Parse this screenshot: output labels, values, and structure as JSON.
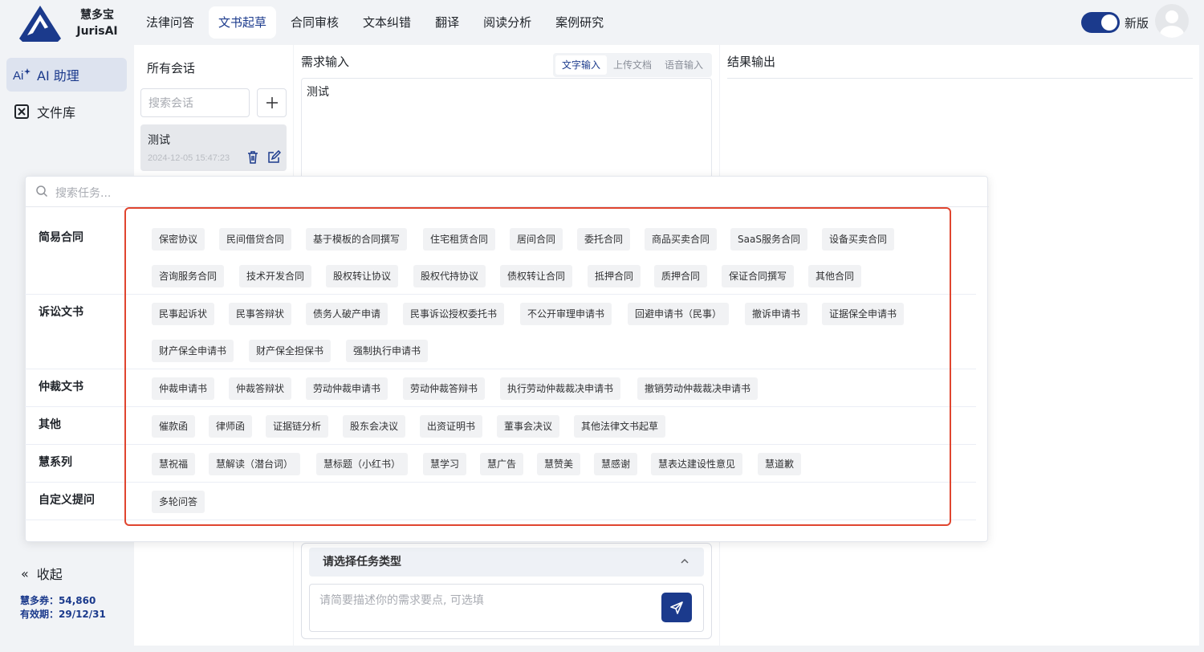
{
  "brand": {
    "name": "慧多宝",
    "sub": "JurisAI"
  },
  "nav": {
    "items": [
      "法律问答",
      "文书起草",
      "合同审核",
      "文本纠错",
      "翻译",
      "阅读分析",
      "案例研究"
    ],
    "active_index": 1
  },
  "header": {
    "version_label": "新版",
    "toggle_on": true
  },
  "sidebar": {
    "items": [
      {
        "label": "AI 助理",
        "icon": "ai-sparkle-icon"
      },
      {
        "label": "文件库",
        "icon": "box-x-icon"
      }
    ],
    "collapse_label": "收起",
    "credits_label": "慧多券：54,860",
    "expiry_label": "有效期：29/12/31"
  },
  "conversations": {
    "title": "所有会话",
    "search_placeholder": "搜索会话",
    "items": [
      {
        "name": "测试",
        "time": "2024-12-05 15:47:23"
      }
    ]
  },
  "request": {
    "title": "需求输入",
    "tabs": [
      "文字输入",
      "上传文档",
      "语音输入"
    ],
    "active_tab": 0,
    "text": "测试",
    "task_select_label": "请选择任务类型",
    "input_placeholder": "请简要描述你的需求要点, 可选填"
  },
  "output": {
    "title": "结果输出"
  },
  "task_popup": {
    "search_placeholder": "搜索任务...",
    "categories": [
      {
        "name": "简易合同",
        "rows": [
          [
            "保密协议",
            "民间借贷合同",
            "基于模板的合同撰写",
            "住宅租赁合同",
            "居间合同",
            "委托合同",
            "商品买卖合同",
            "SaaS服务合同",
            "设备买卖合同"
          ],
          [
            "咨询服务合同",
            "技术开发合同",
            "股权转让协议",
            "股权代持协议",
            "债权转让合同",
            "抵押合同",
            "质押合同",
            "保证合同撰写",
            "其他合同"
          ]
        ]
      },
      {
        "name": "诉讼文书",
        "rows": [
          [
            "民事起诉状",
            "民事答辩状",
            "债务人破产申请",
            "民事诉讼授权委托书",
            "不公开审理申请书",
            "回避申请书（民事）",
            "撤诉申请书",
            "证据保全申请书"
          ],
          [
            "财产保全申请书",
            "财产保全担保书",
            "强制执行申请书"
          ]
        ]
      },
      {
        "name": "仲裁文书",
        "rows": [
          [
            "仲裁申请书",
            "仲裁答辩状",
            "劳动仲裁申请书",
            "劳动仲裁答辩书",
            "执行劳动仲裁裁决申请书",
            "撤销劳动仲裁裁决申请书"
          ]
        ]
      },
      {
        "name": "其他",
        "rows": [
          [
            "催款函",
            "律师函",
            "证据链分析",
            "股东会决议",
            "出资证明书",
            "董事会决议",
            "其他法律文书起草"
          ]
        ]
      },
      {
        "name": "慧系列",
        "rows": [
          [
            "慧祝福",
            "慧解读（潜台词）",
            "慧标题（小红书）",
            "慧学习",
            "慧广告",
            "慧赞美",
            "慧感谢",
            "慧表达建设性意见",
            "慧道歉"
          ]
        ]
      },
      {
        "name": "自定义提问",
        "rows": [
          [
            "多轮问答"
          ]
        ]
      }
    ]
  },
  "colors": {
    "brand": "#1b3a8c",
    "highlight": "#e0452f"
  }
}
